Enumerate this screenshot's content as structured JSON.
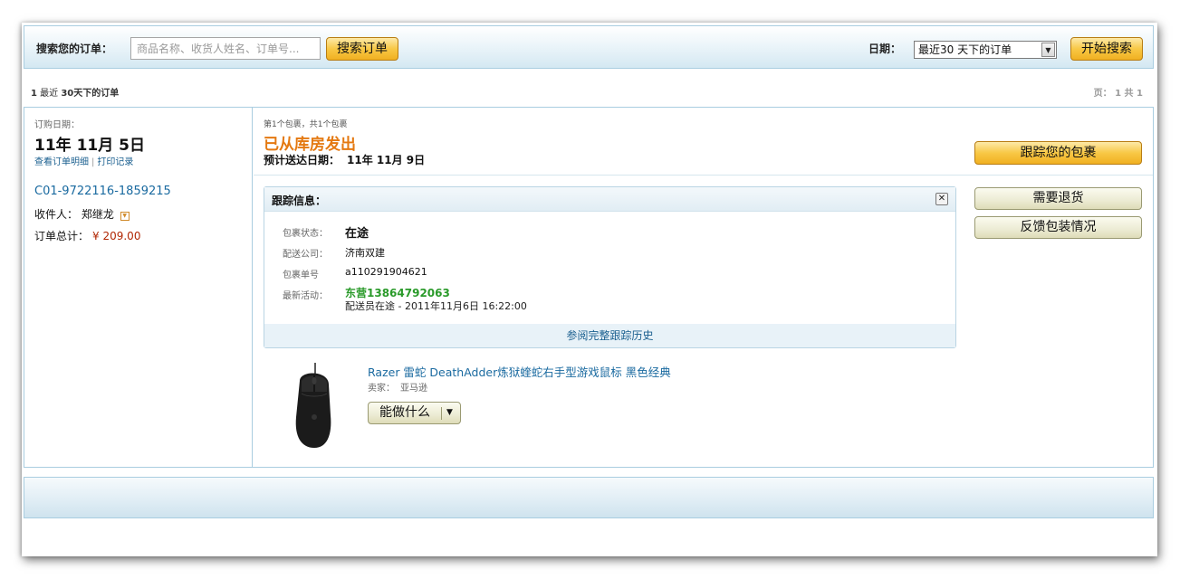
{
  "search": {
    "label": "搜索您的订单：",
    "placeholder": "商品名称、收货人姓名、订单号...",
    "button": "搜索订单"
  },
  "date_filter": {
    "label": "日期：",
    "selected": "最近30 天下的订单",
    "button": "开始搜索"
  },
  "summary": {
    "count": "1",
    "text_a": "最近",
    "text_b": "30天下的订单",
    "pager": "页： 1 共 1"
  },
  "order": {
    "date_label": "订购日期：",
    "date": "11年 11月 5日",
    "link_details": "查看订单明细",
    "link_print": "打印记录",
    "link_sep": "|",
    "order_id": "C01-9722116-1859215",
    "recipient_label": "收件人：",
    "recipient_name": "郑继龙",
    "total_label": "订单总计：",
    "total_amount": "¥ 209.00"
  },
  "shipment": {
    "package_count": "第1个包裹，共1个包裹",
    "status": "已从库房发出",
    "eta_label": "预计送达日期：",
    "eta_date": "11年 11月 9日",
    "track_button": "跟踪您的包裹",
    "return_button": "需要退货",
    "feedback_button": "反馈包装情况"
  },
  "tracking": {
    "title": "跟踪信息：",
    "status_label": "包裹状态：",
    "status_value": "在途",
    "carrier_label": "配送公司：",
    "carrier_value": "济南双建",
    "tracking_no_label": "包裹单号",
    "tracking_no_value": "a110291904621",
    "latest_label": "最新活动：",
    "latest_location": "东营13864792063",
    "latest_detail": "配送员在途 - 2011年11月6日 16:22:00",
    "history_link": "参阅完整跟踪历史"
  },
  "product": {
    "title": "Razer 雷蛇 DeathAdder炼狱蝰蛇右手型游戏鼠标 黑色经典",
    "seller_label": "卖家：",
    "seller_name": "亚马逊",
    "action_button": "能做什么"
  }
}
